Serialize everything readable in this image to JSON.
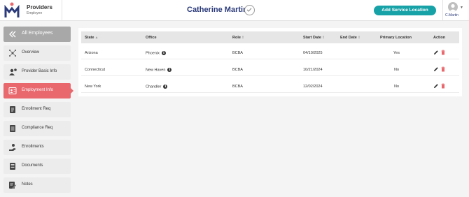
{
  "header": {
    "brand_title": "Providers",
    "brand_subtitle": "Employee",
    "person_name": "Catherine Martin",
    "add_location_label": "Add Service Location",
    "user_label": "C.Martin",
    "colors": {
      "accent": "#17a2a8",
      "name": "#2a3a7a",
      "active": "#e8686e"
    }
  },
  "sidebar": {
    "items": [
      {
        "label": "All Employees",
        "icon": "back-arrows-icon"
      },
      {
        "label": "Overview",
        "icon": "network-icon"
      },
      {
        "label": "Provider Basic Info",
        "icon": "user-info-icon"
      },
      {
        "label": "Employment Info",
        "icon": "id-card-icon"
      },
      {
        "label": "Enrollment Req",
        "icon": "clipboard-icon"
      },
      {
        "label": "Compliance Req",
        "icon": "checklist-icon"
      },
      {
        "label": "Enrollments",
        "icon": "hand-user-icon"
      },
      {
        "label": "Documents",
        "icon": "document-icon"
      },
      {
        "label": "Notes",
        "icon": "note-edit-icon"
      }
    ]
  },
  "table": {
    "columns": [
      "State",
      "Office",
      "Role",
      "Start Date",
      "End Date",
      "Primary Location",
      "Action"
    ],
    "rows": [
      {
        "state": "Arizona",
        "office": "Phoenix",
        "role": "BCBA",
        "start_date": "04/10/2025",
        "end_date": "",
        "primary": "Yes"
      },
      {
        "state": "Connecticut",
        "office": "New Haven",
        "role": "BCBA",
        "start_date": "10/21/2024",
        "end_date": "",
        "primary": "No"
      },
      {
        "state": "New York",
        "office": "Chandler",
        "role": "BCBA",
        "start_date": "12/02/2024",
        "end_date": "",
        "primary": "No"
      }
    ]
  }
}
